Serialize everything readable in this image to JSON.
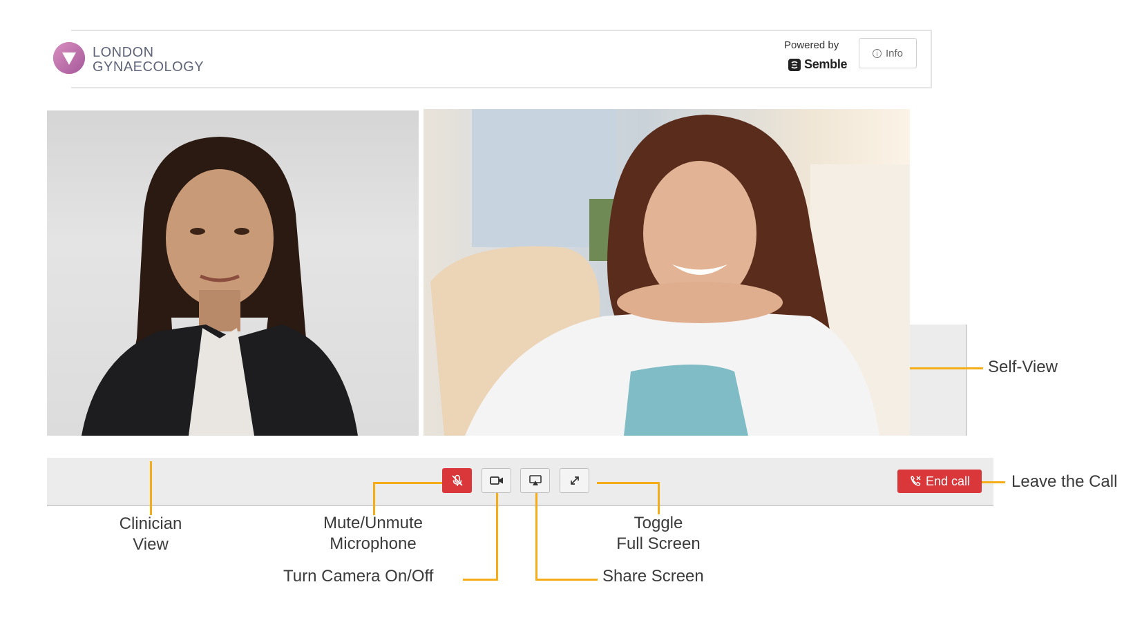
{
  "header": {
    "brand_line1": "LONDON",
    "brand_line2": "GYNAECOLOGY",
    "powered_by": "Powered by",
    "platform_name": "Semble",
    "info_label": "Info"
  },
  "controls": {
    "mute_icon": "microphone-off-icon",
    "camera_icon": "video-camera-icon",
    "share_icon": "screen-share-icon",
    "fullscreen_icon": "expand-icon",
    "end_call_label": "End call"
  },
  "annotations": {
    "self_view": "Self-View",
    "leave_call": "Leave the Call",
    "clinician_view_1": "Clinician",
    "clinician_view_2": "View",
    "mute_1": "Mute/Unmute",
    "mute_2": "Microphone",
    "camera": "Turn Camera On/Off",
    "toggle_1": "Toggle",
    "toggle_2": "Full Screen",
    "share": "Share Screen"
  },
  "colors": {
    "accent_red": "#d9373a",
    "annotation_line": "#f5ad17",
    "brand_text": "#5e6479"
  }
}
